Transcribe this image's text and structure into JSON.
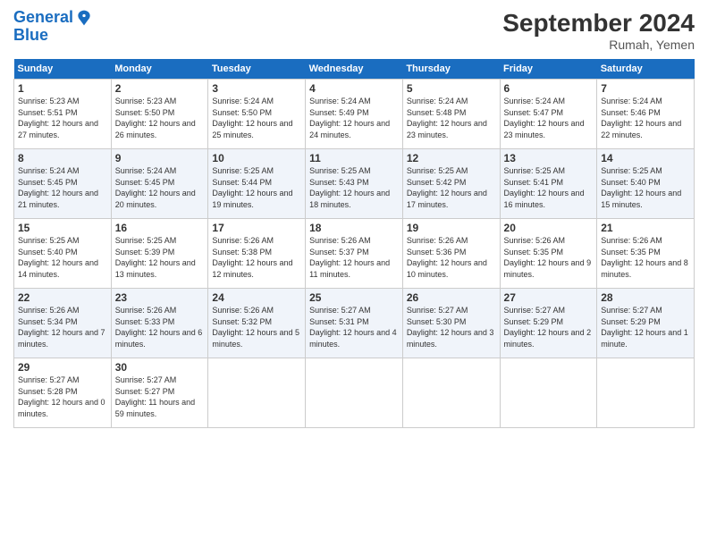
{
  "logo": {
    "line1": "General",
    "line2": "Blue"
  },
  "title": "September 2024",
  "location": "Rumah, Yemen",
  "days_header": [
    "Sunday",
    "Monday",
    "Tuesday",
    "Wednesday",
    "Thursday",
    "Friday",
    "Saturday"
  ],
  "weeks": [
    [
      {
        "day": "1",
        "sunrise": "5:23 AM",
        "sunset": "5:51 PM",
        "daylight": "12 hours and 27 minutes."
      },
      {
        "day": "2",
        "sunrise": "5:23 AM",
        "sunset": "5:50 PM",
        "daylight": "12 hours and 26 minutes."
      },
      {
        "day": "3",
        "sunrise": "5:24 AM",
        "sunset": "5:50 PM",
        "daylight": "12 hours and 25 minutes."
      },
      {
        "day": "4",
        "sunrise": "5:24 AM",
        "sunset": "5:49 PM",
        "daylight": "12 hours and 24 minutes."
      },
      {
        "day": "5",
        "sunrise": "5:24 AM",
        "sunset": "5:48 PM",
        "daylight": "12 hours and 23 minutes."
      },
      {
        "day": "6",
        "sunrise": "5:24 AM",
        "sunset": "5:47 PM",
        "daylight": "12 hours and 23 minutes."
      },
      {
        "day": "7",
        "sunrise": "5:24 AM",
        "sunset": "5:46 PM",
        "daylight": "12 hours and 22 minutes."
      }
    ],
    [
      {
        "day": "8",
        "sunrise": "5:24 AM",
        "sunset": "5:45 PM",
        "daylight": "12 hours and 21 minutes."
      },
      {
        "day": "9",
        "sunrise": "5:24 AM",
        "sunset": "5:45 PM",
        "daylight": "12 hours and 20 minutes."
      },
      {
        "day": "10",
        "sunrise": "5:25 AM",
        "sunset": "5:44 PM",
        "daylight": "12 hours and 19 minutes."
      },
      {
        "day": "11",
        "sunrise": "5:25 AM",
        "sunset": "5:43 PM",
        "daylight": "12 hours and 18 minutes."
      },
      {
        "day": "12",
        "sunrise": "5:25 AM",
        "sunset": "5:42 PM",
        "daylight": "12 hours and 17 minutes."
      },
      {
        "day": "13",
        "sunrise": "5:25 AM",
        "sunset": "5:41 PM",
        "daylight": "12 hours and 16 minutes."
      },
      {
        "day": "14",
        "sunrise": "5:25 AM",
        "sunset": "5:40 PM",
        "daylight": "12 hours and 15 minutes."
      }
    ],
    [
      {
        "day": "15",
        "sunrise": "5:25 AM",
        "sunset": "5:40 PM",
        "daylight": "12 hours and 14 minutes."
      },
      {
        "day": "16",
        "sunrise": "5:25 AM",
        "sunset": "5:39 PM",
        "daylight": "12 hours and 13 minutes."
      },
      {
        "day": "17",
        "sunrise": "5:26 AM",
        "sunset": "5:38 PM",
        "daylight": "12 hours and 12 minutes."
      },
      {
        "day": "18",
        "sunrise": "5:26 AM",
        "sunset": "5:37 PM",
        "daylight": "12 hours and 11 minutes."
      },
      {
        "day": "19",
        "sunrise": "5:26 AM",
        "sunset": "5:36 PM",
        "daylight": "12 hours and 10 minutes."
      },
      {
        "day": "20",
        "sunrise": "5:26 AM",
        "sunset": "5:35 PM",
        "daylight": "12 hours and 9 minutes."
      },
      {
        "day": "21",
        "sunrise": "5:26 AM",
        "sunset": "5:35 PM",
        "daylight": "12 hours and 8 minutes."
      }
    ],
    [
      {
        "day": "22",
        "sunrise": "5:26 AM",
        "sunset": "5:34 PM",
        "daylight": "12 hours and 7 minutes."
      },
      {
        "day": "23",
        "sunrise": "5:26 AM",
        "sunset": "5:33 PM",
        "daylight": "12 hours and 6 minutes."
      },
      {
        "day": "24",
        "sunrise": "5:26 AM",
        "sunset": "5:32 PM",
        "daylight": "12 hours and 5 minutes."
      },
      {
        "day": "25",
        "sunrise": "5:27 AM",
        "sunset": "5:31 PM",
        "daylight": "12 hours and 4 minutes."
      },
      {
        "day": "26",
        "sunrise": "5:27 AM",
        "sunset": "5:30 PM",
        "daylight": "12 hours and 3 minutes."
      },
      {
        "day": "27",
        "sunrise": "5:27 AM",
        "sunset": "5:29 PM",
        "daylight": "12 hours and 2 minutes."
      },
      {
        "day": "28",
        "sunrise": "5:27 AM",
        "sunset": "5:29 PM",
        "daylight": "12 hours and 1 minute."
      }
    ],
    [
      {
        "day": "29",
        "sunrise": "5:27 AM",
        "sunset": "5:28 PM",
        "daylight": "12 hours and 0 minutes."
      },
      {
        "day": "30",
        "sunrise": "5:27 AM",
        "sunset": "5:27 PM",
        "daylight": "11 hours and 59 minutes."
      },
      null,
      null,
      null,
      null,
      null
    ]
  ]
}
